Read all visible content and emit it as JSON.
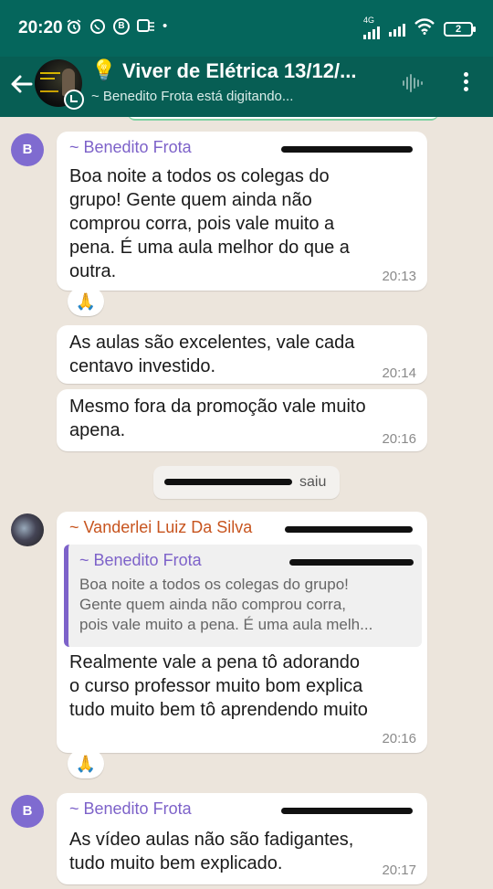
{
  "status_bar": {
    "time": "20:20",
    "icons": [
      "alarm-icon",
      "whatsapp-icon",
      "b-icon",
      "sim-card-icon"
    ],
    "dot": "•",
    "network": "4G",
    "battery": "2"
  },
  "header": {
    "title": "Viver de Elétrica 13/12/...",
    "subtitle": "~ Benedito Frota está digitando..."
  },
  "messages": [
    {
      "sender": "~ Benedito Frota",
      "text": "Boa noite a todos os colegas do\ngrupo! Gente quem ainda não\ncomprou corra, pois vale muito a\npena. É uma aula melhor do que a\noutra.",
      "time": "20:13",
      "reaction": "🙏"
    },
    {
      "text": "As aulas são excelentes, vale cada\ncentavo investido.",
      "time": "20:14"
    },
    {
      "text": "Mesmo fora da promoção  vale muito\napena.",
      "time": "20:16"
    },
    {
      "system_text": "saiu"
    },
    {
      "sender": "~ Vanderlei Luiz  Da Silva",
      "quote_sender": "~ Benedito Frota",
      "quote_text": "Boa noite a todos os colegas do grupo!\nGente quem ainda não comprou corra,\npois vale muito a pena. É uma aula melh...",
      "text": "Realmente vale a pena tô adorando\no curso professor muito bom explica\ntudo muito bem tô aprendendo muito",
      "time": "20:16",
      "reaction": "🙏"
    },
    {
      "sender": "~ Benedito Frota",
      "text": "As vídeo aulas não são fadigantes,\ntudo muito bem explicado.",
      "time": "20:17"
    }
  ],
  "avatar_letter": "B",
  "colors": {
    "header": "#075e54",
    "status_bar": "#05665c",
    "chat_background": "#ece5dc",
    "sender_purple": "#7d62c9",
    "sender_orange": "#c7541e"
  }
}
